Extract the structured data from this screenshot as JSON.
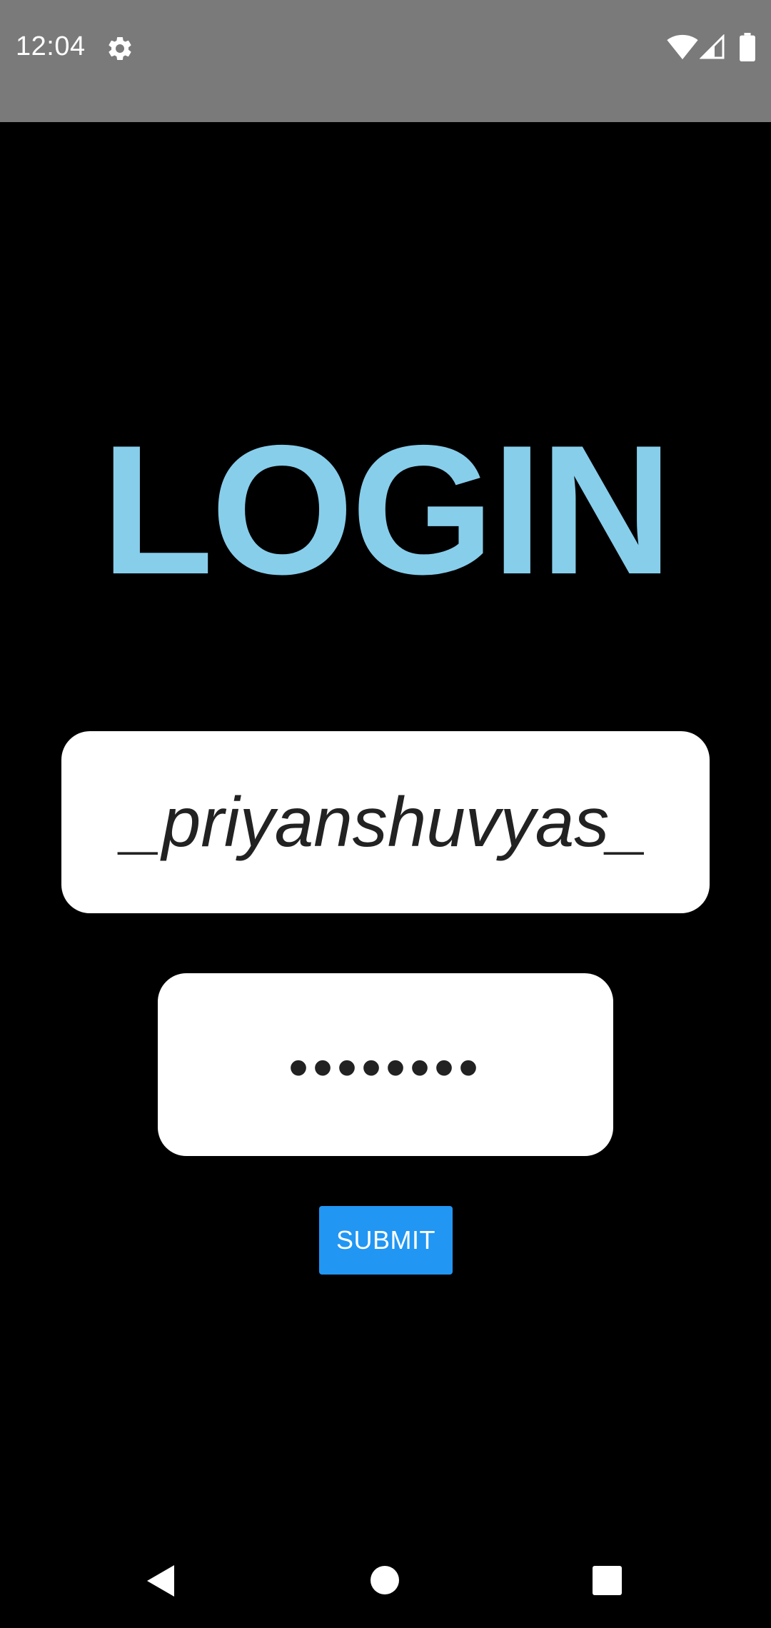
{
  "status_bar": {
    "time": "12:04",
    "icons": [
      "gear-icon",
      "wifi-icon",
      "cell-signal-icon",
      "battery-icon"
    ]
  },
  "title": "LOGIN",
  "form": {
    "username_value": "_priyanshuvyas_",
    "password_mask": "••••••••",
    "submit_label": "SUBMIT"
  },
  "nav_bar": {
    "icons": [
      "back-icon",
      "home-icon",
      "recents-icon"
    ]
  },
  "colors": {
    "background": "#000000",
    "status_bar": "#7a7a7a",
    "title": "#87ceeb",
    "field_background": "#ffffff",
    "button": "#2196f3"
  }
}
